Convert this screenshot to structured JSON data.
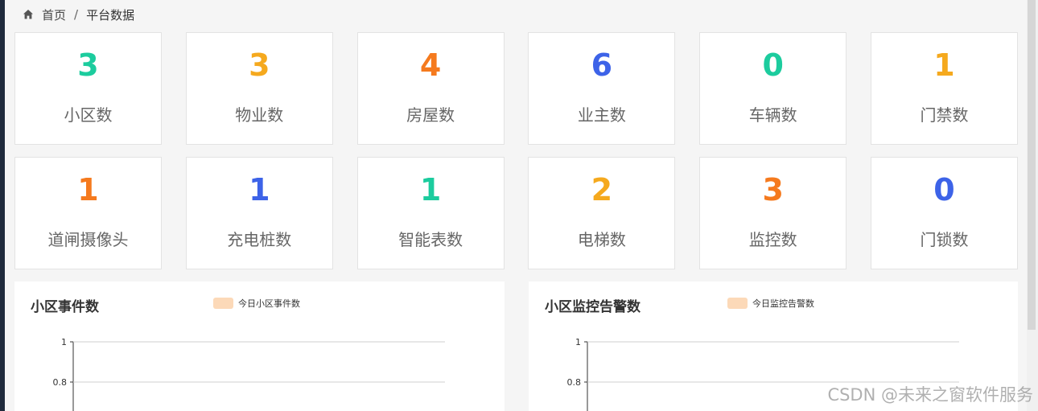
{
  "breadcrumb": {
    "home": "首页",
    "separator": "/",
    "current": "平台数据"
  },
  "stats": [
    {
      "value": "3",
      "label": "小区数",
      "color": "#1ccc9e"
    },
    {
      "value": "3",
      "label": "物业数",
      "color": "#f5a91e"
    },
    {
      "value": "4",
      "label": "房屋数",
      "color": "#f57a1e"
    },
    {
      "value": "6",
      "label": "业主数",
      "color": "#3d63e8"
    },
    {
      "value": "0",
      "label": "车辆数",
      "color": "#1ccc9e"
    },
    {
      "value": "1",
      "label": "门禁数",
      "color": "#f5a91e"
    },
    {
      "value": "1",
      "label": "道闸摄像头",
      "color": "#f57a1e"
    },
    {
      "value": "1",
      "label": "充电桩数",
      "color": "#3d63e8"
    },
    {
      "value": "1",
      "label": "智能表数",
      "color": "#1ccc9e"
    },
    {
      "value": "2",
      "label": "电梯数",
      "color": "#f5a91e"
    },
    {
      "value": "3",
      "label": "监控数",
      "color": "#f57a1e"
    },
    {
      "value": "0",
      "label": "门锁数",
      "color": "#3d63e8"
    }
  ],
  "panels": {
    "left": {
      "title": "小区事件数",
      "legend": "今日小区事件数",
      "swatch_color": "#fcd9b8"
    },
    "right": {
      "title": "小区监控告警数",
      "legend": "今日监控告警数",
      "swatch_color": "#fcd9b8"
    }
  },
  "chart_data": [
    {
      "type": "line",
      "series": [
        {
          "name": "今日小区事件数",
          "values": []
        }
      ],
      "yticks": [
        "1",
        "0.8"
      ],
      "ylim": [
        0.8,
        1
      ]
    },
    {
      "type": "line",
      "series": [
        {
          "name": "今日监控告警数",
          "values": []
        }
      ],
      "yticks": [
        "1",
        "0.8"
      ],
      "ylim": [
        0.8,
        1
      ]
    }
  ],
  "watermark": "CSDN @未来之窗软件服务"
}
